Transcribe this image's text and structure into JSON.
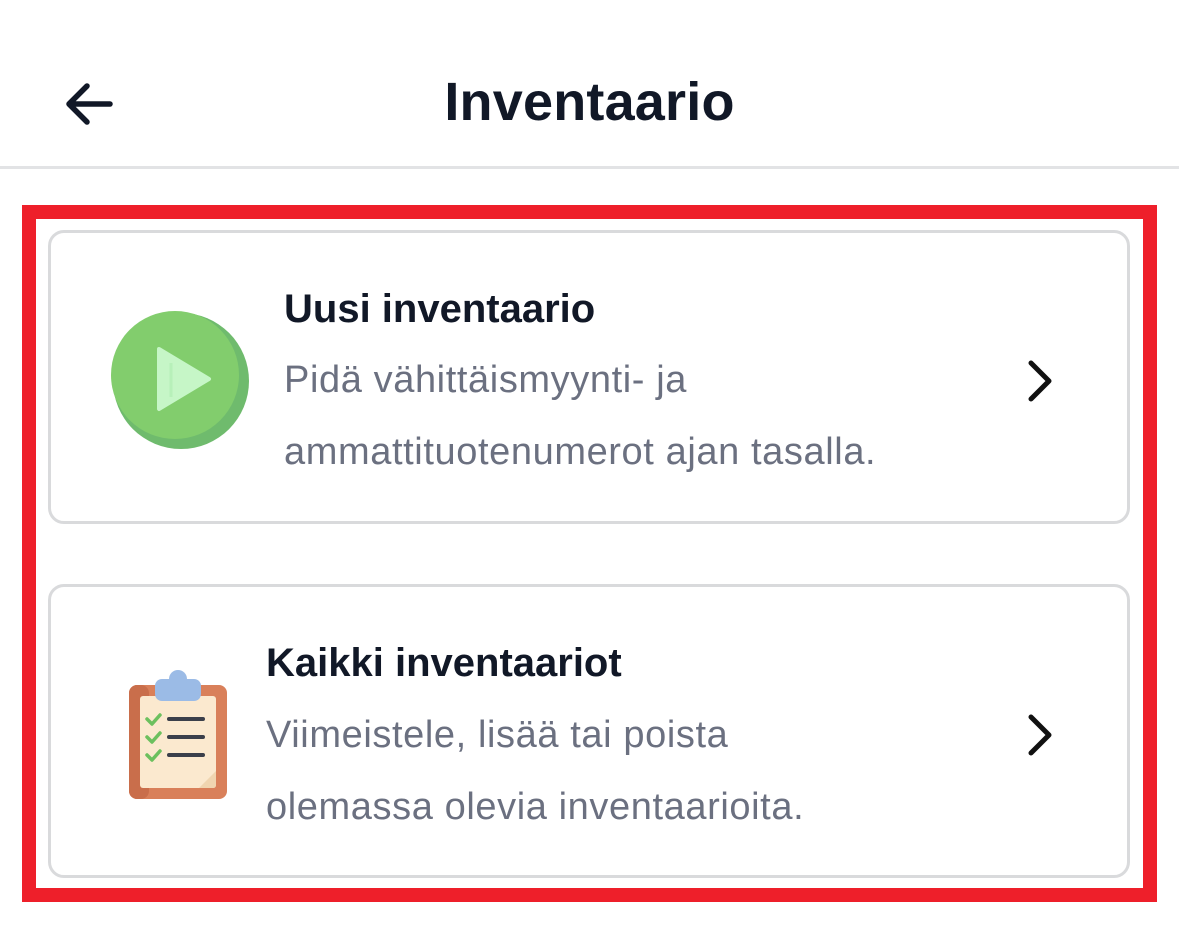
{
  "header": {
    "title": "Inventaario",
    "back_icon": "arrow-left-icon"
  },
  "highlight_color": "#ee1f2a",
  "cards": [
    {
      "title": "Uusi inventaario",
      "description": "Pidä vähittäismyynti- ja\nammattituotenumerot ajan tasalla.",
      "icon": "play-circle-icon",
      "icon_colors": [
        "#7ecb6c",
        "#64b66b",
        "#c5f5c8"
      ]
    },
    {
      "title": "Kaikki inventaariot",
      "description": "Viimeistele, lisää tai poista\nolemassa olevia inventaarioita.",
      "icon": "clipboard-checklist-icon",
      "icon_colors": [
        "#d9805a",
        "#fbe9cf",
        "#9bbbe6",
        "#6cc05e"
      ]
    }
  ]
}
